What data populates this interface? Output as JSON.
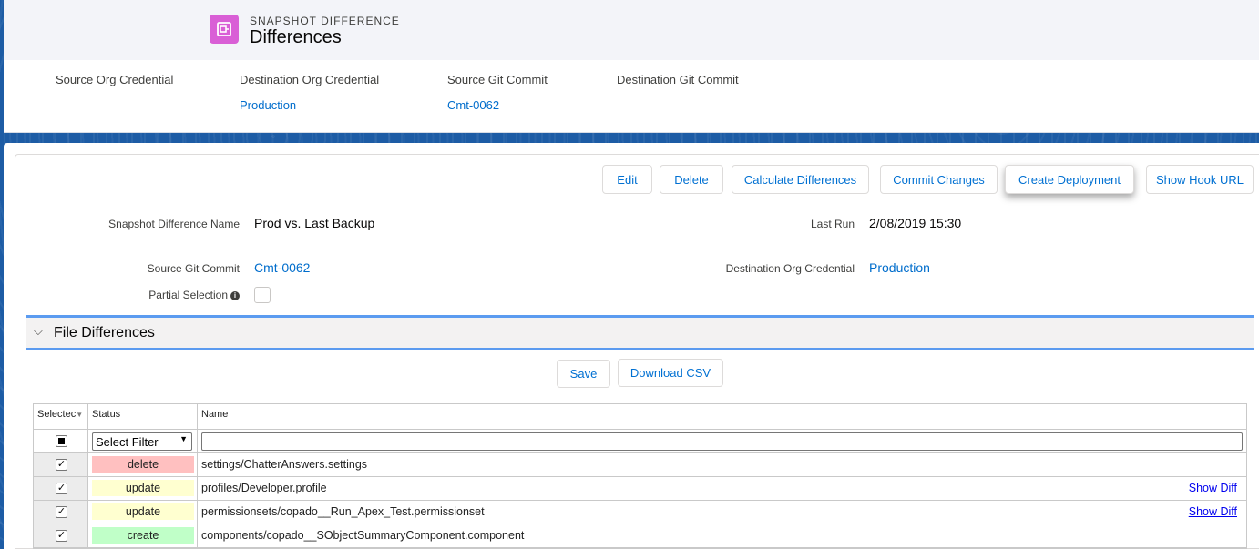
{
  "header": {
    "object_type": "Snapshot Difference",
    "title": "Differences",
    "highlights": [
      {
        "label": "Source Org Credential",
        "value": ""
      },
      {
        "label": "Destination Org Credential",
        "value": "Production"
      },
      {
        "label": "Source Git Commit",
        "value": "Cmt-0062"
      },
      {
        "label": "Destination Git Commit",
        "value": ""
      }
    ]
  },
  "actions": {
    "edit": "Edit",
    "delete": "Delete",
    "calculate": "Calculate Differences",
    "commit": "Commit Changes",
    "create_deployment": "Create Deployment",
    "show_hook": "Show Hook URL"
  },
  "details": {
    "name_label": "Snapshot Difference Name",
    "name_value": "Prod vs. Last Backup",
    "last_run_label": "Last Run",
    "last_run_value": "2/08/2019 15:30",
    "source_commit_label": "Source Git Commit",
    "source_commit_value": "Cmt-0062",
    "dest_org_label": "Destination Org Credential",
    "dest_org_value": "Production",
    "partial_label": "Partial Selection"
  },
  "section": {
    "title": "File Differences",
    "save": "Save",
    "download": "Download CSV"
  },
  "grid": {
    "headers": {
      "selected": "Selectec",
      "status": "Status",
      "name": "Name"
    },
    "filter_placeholder": "Select Filter",
    "rows": [
      {
        "selected": true,
        "status": "delete",
        "status_color": "#ffc0c0",
        "name": "settings/ChatterAnswers.settings",
        "action": ""
      },
      {
        "selected": true,
        "status": "update",
        "status_color": "#ffffd0",
        "name": "profiles/Developer.profile",
        "action": "Show Diff"
      },
      {
        "selected": true,
        "status": "update",
        "status_color": "#ffffd0",
        "name": "permissionsets/copado__Run_Apex_Test.permissionset",
        "action": "Show Diff"
      },
      {
        "selected": true,
        "status": "create",
        "status_color": "#c0ffc8",
        "name": "components/copado__SObjectSummaryComponent.component",
        "action": ""
      }
    ]
  }
}
